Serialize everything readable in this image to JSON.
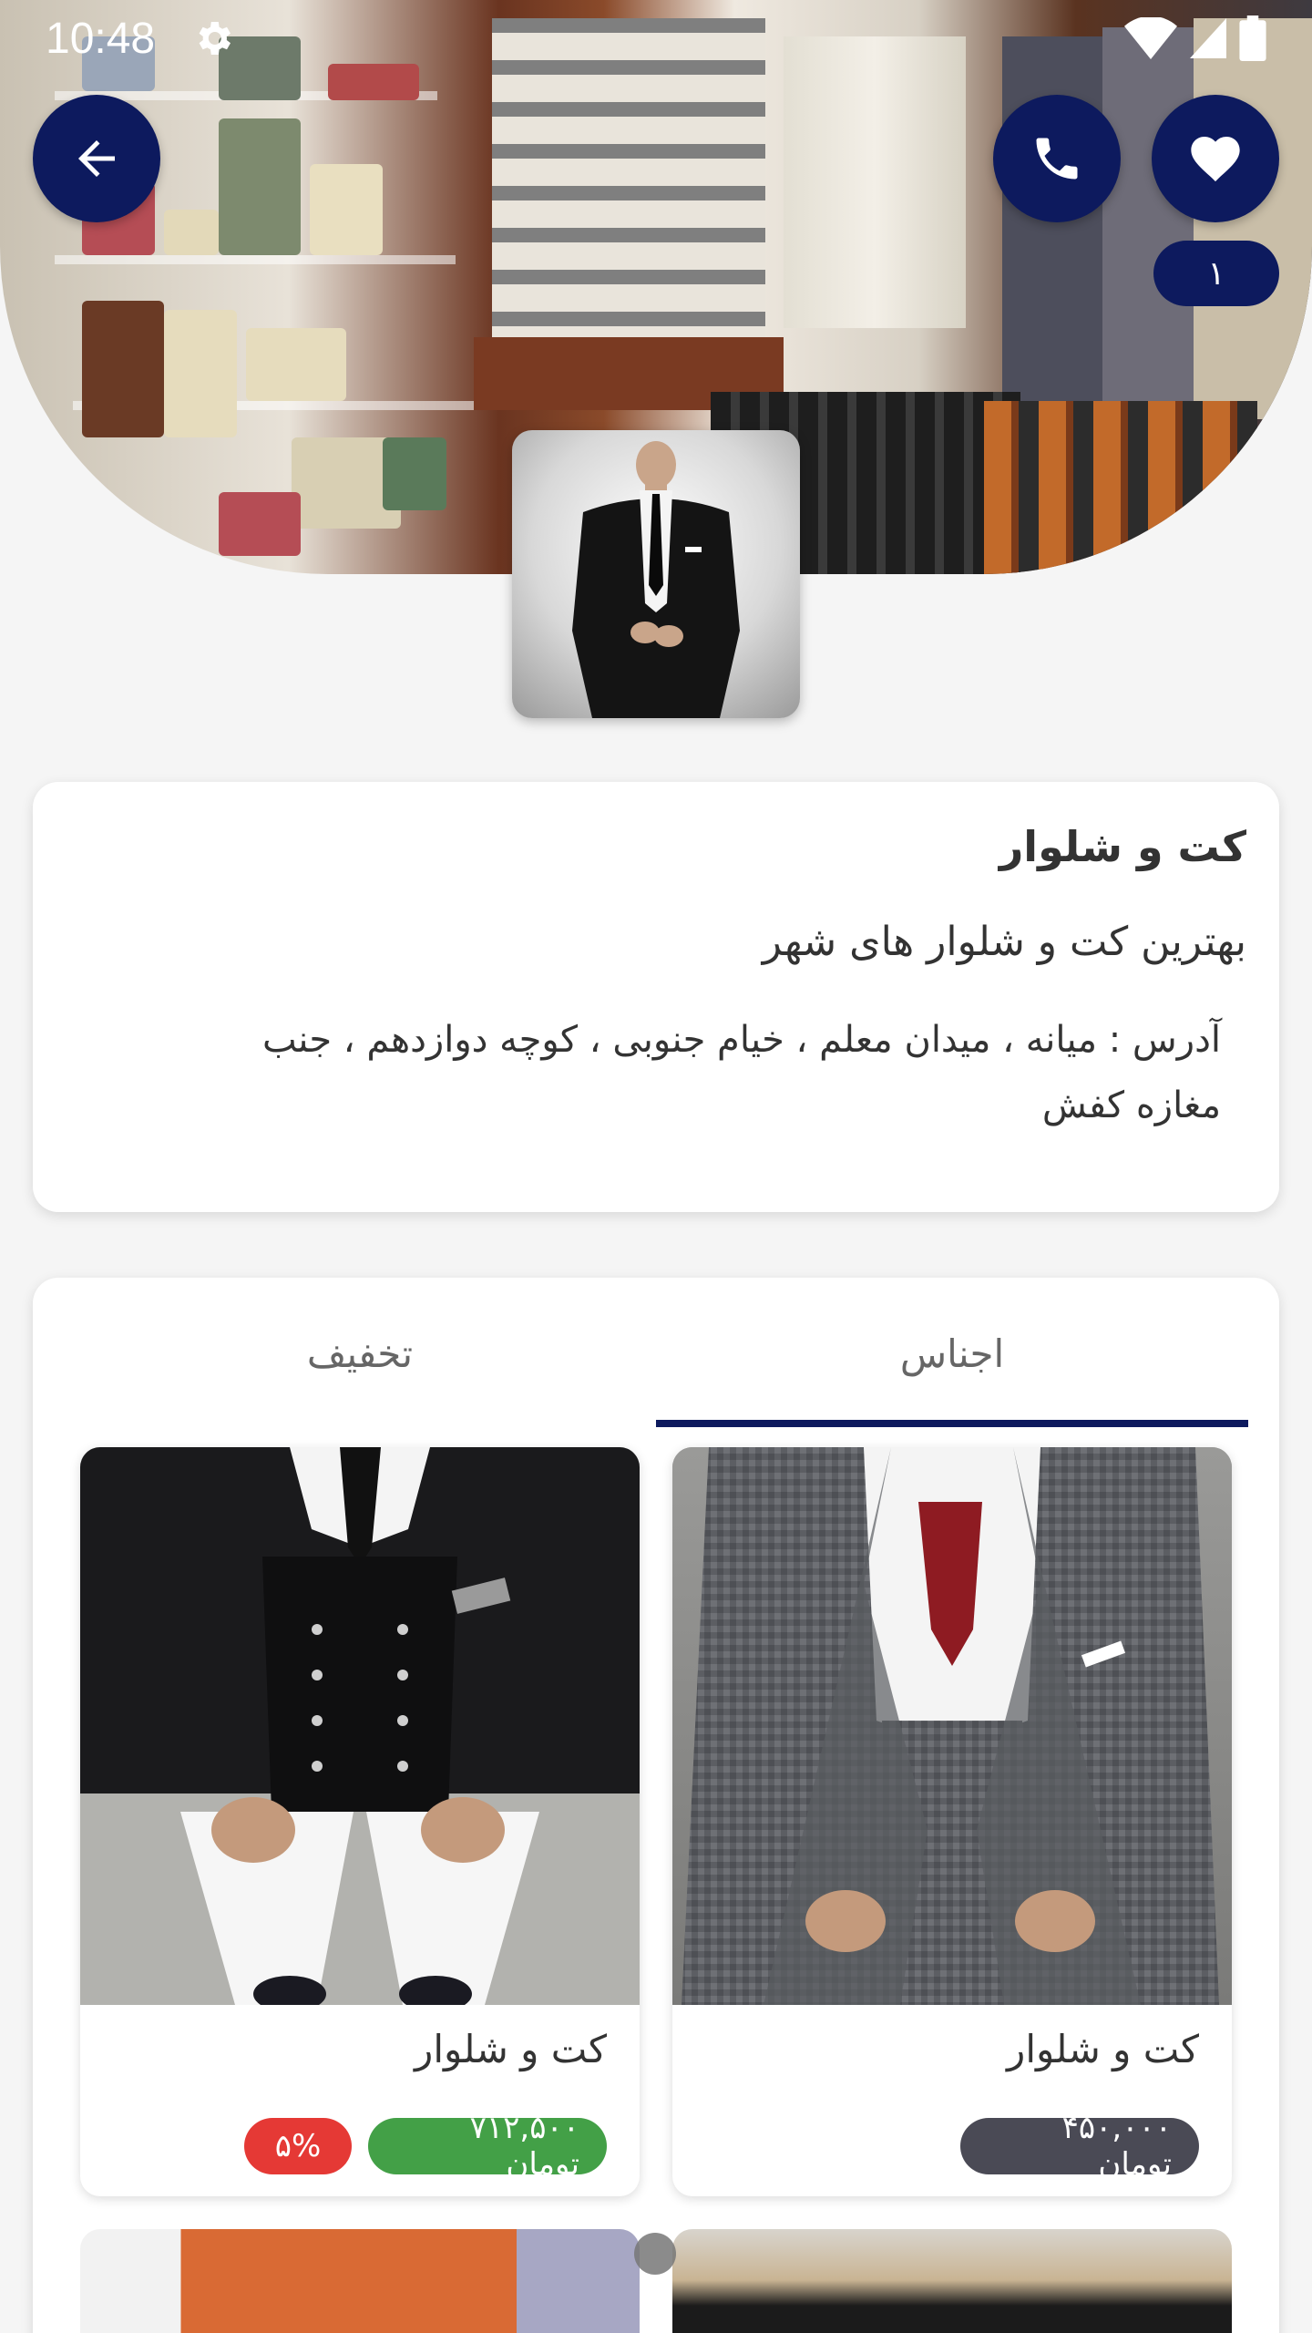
{
  "status_bar": {
    "time": "10:48"
  },
  "header": {
    "favorite_count": "۱"
  },
  "shop": {
    "title": "کت و شلوار",
    "slogan": "بهترین کت و شلوار های شهر",
    "address": "آدرس : میانه ، میدان معلم ، خیام جنوبی ، کوچه دوازدهم ، جنب مغازه کفش"
  },
  "tabs": [
    {
      "label": "اجناس",
      "active": true
    },
    {
      "label": "تخفیف",
      "active": false
    }
  ],
  "products": [
    {
      "name": "کت و شلوار",
      "price": "۴۵۰,۰۰۰ تومان",
      "price_color": "#4a4a55",
      "discount": ""
    },
    {
      "name": "کت و شلوار",
      "price": "۷۱۲,۵۰۰ تومان",
      "price_color": "#43a047",
      "discount": "۵%"
    }
  ],
  "colors": {
    "primary": "#0d1a5e",
    "discount": "#e53935",
    "sale_price": "#43a047"
  },
  "icons": [
    "back-arrow-icon",
    "phone-icon",
    "heart-icon",
    "settings-icon",
    "wifi-icon",
    "signal-icon",
    "battery-icon"
  ]
}
